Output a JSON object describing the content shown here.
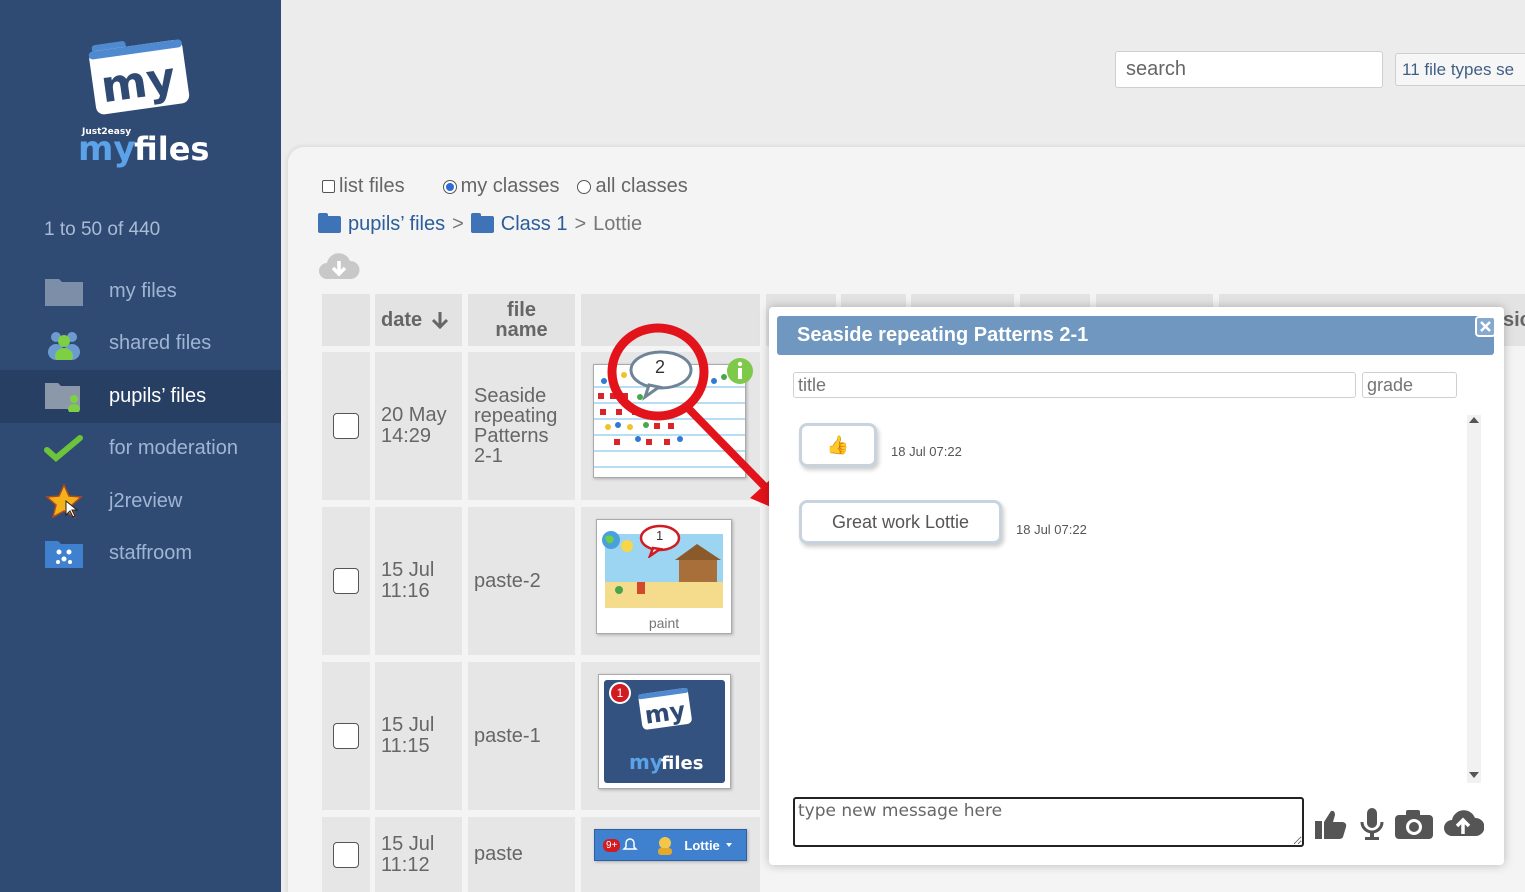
{
  "sidebar": {
    "count": "1 to 50 of 440",
    "items": [
      {
        "label": "my files"
      },
      {
        "label": "shared files"
      },
      {
        "label": "pupils’ files"
      },
      {
        "label": "for moderation"
      },
      {
        "label": "j2review"
      },
      {
        "label": "staffroom"
      }
    ]
  },
  "top": {
    "search_placeholder": "search",
    "file_types": "11 file types se"
  },
  "options": {
    "list_files": "list files",
    "my_classes": "my classes",
    "all_classes": "all classes"
  },
  "breadcrumb": {
    "root": "pupils’ files",
    "sep": ">",
    "class": "Class 1",
    "pupil": "Lottie"
  },
  "table": {
    "headers": {
      "date": "date",
      "file_name_1": "file",
      "file_name_2": "name"
    },
    "rows": [
      {
        "date": "20 May",
        "time": "14:29",
        "name": [
          "Seaside",
          "repeating",
          "Patterns",
          "2-1"
        ],
        "comments": "2"
      },
      {
        "date": "15 Jul",
        "time": "11:16",
        "name": [
          "paste-2"
        ],
        "comments": "1",
        "caption": "paint"
      },
      {
        "date": "15 Jul",
        "time": "11:15",
        "name": [
          "paste-1"
        ],
        "comments": "1"
      },
      {
        "date": "15 Jul",
        "time": "11:12",
        "name": [
          "paste"
        ],
        "badge": "9+",
        "user": "Lottie"
      }
    ]
  },
  "modal": {
    "title": "Seaside repeating Patterns 2-1",
    "title_placeholder": "title",
    "grade_placeholder": "grade",
    "messages": [
      {
        "text": "👍",
        "time": "18 Jul 07:22"
      },
      {
        "text": "Great work Lottie",
        "time": "18 Jul 07:22"
      }
    ],
    "input_placeholder": "type new message here",
    "edge_text": "sic"
  },
  "colors": {
    "sidebar_bg": "#2f4a73",
    "active_item_bg": "#273f63",
    "modal_header": "#6f97bf",
    "annotation_red": "#e3131b"
  }
}
